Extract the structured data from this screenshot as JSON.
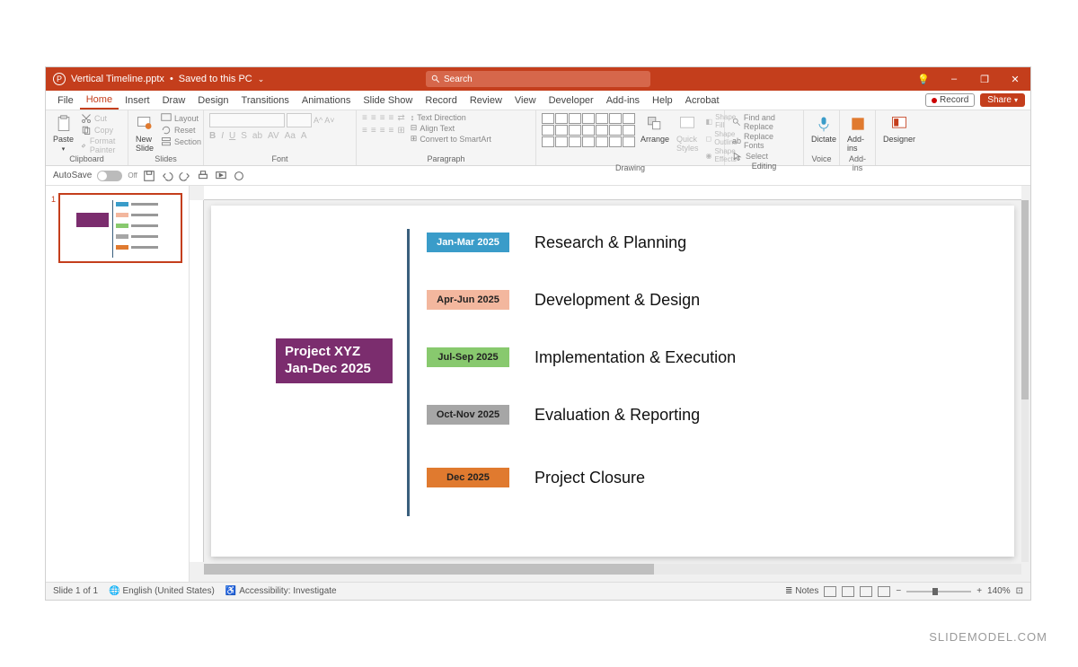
{
  "title": {
    "filename": "Vertical Timeline.pptx",
    "save_state": "Saved to this PC"
  },
  "search": {
    "placeholder": "Search"
  },
  "window_controls": {
    "minimize": "–",
    "restore": "❐",
    "close": "✕",
    "lightbulb": "💡"
  },
  "tabs": [
    "File",
    "Home",
    "Insert",
    "Draw",
    "Design",
    "Transitions",
    "Animations",
    "Slide Show",
    "Record",
    "Review",
    "View",
    "Developer",
    "Add-ins",
    "Help",
    "Acrobat"
  ],
  "tabs_active_index": 1,
  "record_btn": "Record",
  "share_btn": "Share",
  "ribbon": {
    "clipboard": {
      "label": "Clipboard",
      "paste": "Paste",
      "cut": "Cut",
      "copy": "Copy",
      "format_painter": "Format Painter"
    },
    "slides": {
      "label": "Slides",
      "new_slide": "New\nSlide",
      "layout": "Layout",
      "reset": "Reset",
      "section": "Section"
    },
    "font": {
      "label": "Font"
    },
    "paragraph": {
      "label": "Paragraph",
      "text_direction": "Text Direction",
      "align_text": "Align Text",
      "convert_smartart": "Convert to SmartArt"
    },
    "drawing": {
      "label": "Drawing",
      "arrange": "Arrange",
      "quick_styles": "Quick\nStyles",
      "shape_fill": "Shape Fill",
      "shape_outline": "Shape Outline",
      "shape_effects": "Shape Effects"
    },
    "editing": {
      "label": "Editing",
      "find": "Find and Replace",
      "replace_fonts": "Replace Fonts",
      "select": "Select"
    },
    "voice": {
      "label": "Voice",
      "dictate": "Dictate"
    },
    "addins": {
      "label": "Add-ins",
      "addins": "Add-ins"
    },
    "designer": {
      "label": "",
      "designer": "Designer"
    }
  },
  "qat": {
    "autosave_label": "AutoSave",
    "autosave_state": "Off"
  },
  "slide": {
    "project_title": "Project XYZ",
    "project_dates": "Jan-Dec 2025",
    "rows": [
      {
        "date": "Jan-Mar 2025",
        "phase": "Research & Planning",
        "color": "#3a9cc9"
      },
      {
        "date": "Apr-Jun 2025",
        "phase": "Development & Design",
        "color": "#f3b79e"
      },
      {
        "date": "Jul-Sep 2025",
        "phase": "Implementation & Execution",
        "color": "#88c96e"
      },
      {
        "date": "Oct-Nov 2025",
        "phase": "Evaluation & Reporting",
        "color": "#a6a6a6"
      },
      {
        "date": "Dec 2025",
        "phase": "Project Closure",
        "color": "#e07a2f"
      }
    ]
  },
  "statusbar": {
    "slide_count": "Slide 1 of 1",
    "language": "English (United States)",
    "accessibility": "Accessibility: Investigate",
    "notes": "Notes",
    "zoom": "140%"
  },
  "watermark": "SLIDEMODEL.COM"
}
